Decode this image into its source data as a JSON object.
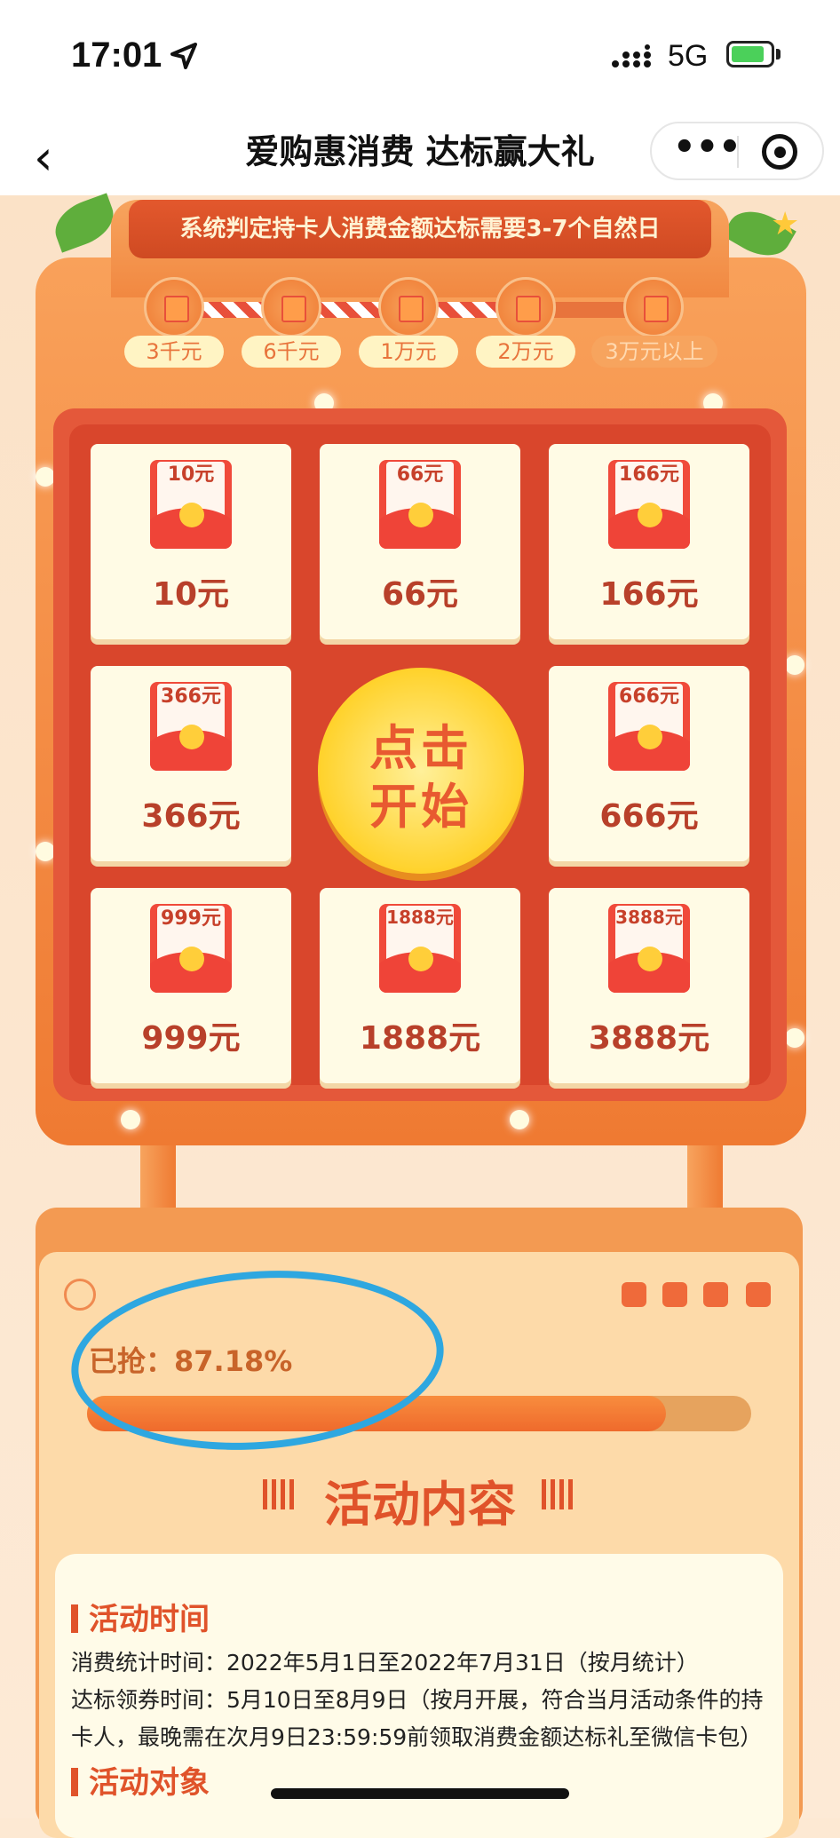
{
  "status": {
    "time": "17:01",
    "network": "5G"
  },
  "header": {
    "title": "爱购惠消费 达标赢大礼",
    "back_label": "‹",
    "more_label": "•••"
  },
  "banner": {
    "text": "系统判定持卡人消费金额达标需要3-7个自然日"
  },
  "milestones": [
    "3千元",
    "6千元",
    "1万元",
    "2万元",
    "3万元以上"
  ],
  "prizes": [
    {
      "card": "10元",
      "amount": "10元"
    },
    {
      "card": "66元",
      "amount": "66元"
    },
    {
      "card": "166元",
      "amount": "166元"
    },
    {
      "card": "366元",
      "amount": "366元"
    },
    {
      "card": "666元",
      "amount": "666元"
    },
    {
      "card": "999元",
      "amount": "999元"
    },
    {
      "card": "1888元",
      "amount": "1888元"
    },
    {
      "card": "3888元",
      "amount": "3888元"
    }
  ],
  "start_button": {
    "line1": "点击",
    "line2": "开始"
  },
  "progress": {
    "label": "已抢：87.18%",
    "value_percent": 87.18
  },
  "activity": {
    "title": "活动内容",
    "time_heading": "活动时间",
    "stat_time": "消费统计时间：2022年5月1日至2022年7月31日（按月统计）",
    "claim_time": "达标领券时间：5月10日至8月9日（按月开展，符合当月活动条件的持卡人，最晚需在次月9日23:59:59前领取消费金额达标礼至微信卡包）",
    "target_heading": "活动对象"
  },
  "colors": {
    "accent": "#e0532a",
    "machine": "#ef7a32",
    "annotation": "#2ea7e0"
  }
}
